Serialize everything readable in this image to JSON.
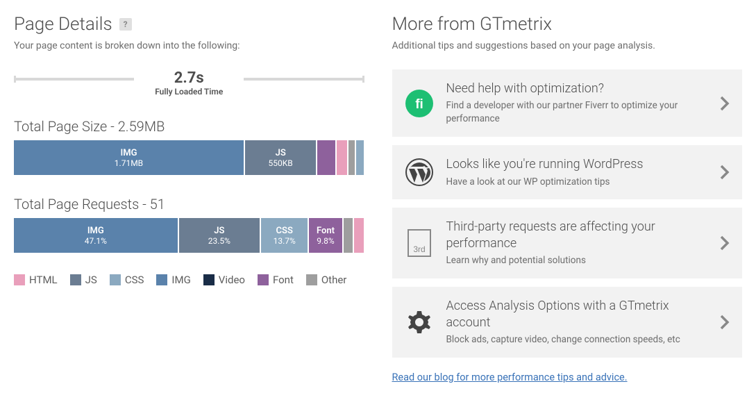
{
  "left": {
    "title": "Page Details",
    "subtitle": "Your page content is broken down into the following:",
    "load_time_value": "2.7s",
    "load_time_label": "Fully Loaded Time",
    "size_title": "Total Page Size - 2.59MB",
    "requests_title": "Total Page Requests - 51"
  },
  "right": {
    "title": "More from GTmetrix",
    "subtitle": "Additional tips and suggestions based on your page analysis.",
    "tips": [
      {
        "title": "Need help with optimization?",
        "desc": "Find a developer with our partner Fiverr to optimize your performance"
      },
      {
        "title": "Looks like you're running WordPress",
        "desc": "Have a look at our WP optimization tips"
      },
      {
        "title": "Third-party requests are affecting your performance",
        "desc": "Learn why and potential solutions"
      },
      {
        "title": "Access Analysis Options with a GTmetrix account",
        "desc": "Block ads, capture video, change connection speeds, etc"
      }
    ],
    "blog_link": "Read our blog for more performance tips and advice."
  },
  "legend": [
    "HTML",
    "JS",
    "CSS",
    "IMG",
    "Video",
    "Font",
    "Other"
  ],
  "colors": {
    "HTML": "#e99fbb",
    "JS": "#6b7d92",
    "CSS": "#8ba9c0",
    "IMG": "#5a82ab",
    "Video": "#1a2d47",
    "Font": "#8e619c",
    "Other": "#9e9e9e"
  },
  "chart_data": [
    {
      "type": "bar",
      "title": "Total Page Size - 2.59MB",
      "total": "2.59MB",
      "segments": [
        {
          "name": "IMG",
          "label": "IMG",
          "value": "1.71MB",
          "percent": 66.0
        },
        {
          "name": "JS",
          "label": "JS",
          "value": "550KB",
          "percent": 20.7
        },
        {
          "name": "Font",
          "label": "",
          "value": "",
          "percent": 5.5
        },
        {
          "name": "HTML",
          "label": "",
          "value": "",
          "percent": 3.4
        },
        {
          "name": "Other",
          "label": "",
          "value": "",
          "percent": 2.2
        },
        {
          "name": "CSS",
          "label": "",
          "value": "",
          "percent": 2.2
        }
      ]
    },
    {
      "type": "bar",
      "title": "Total Page Requests - 51",
      "total": 51,
      "segments": [
        {
          "name": "IMG",
          "label": "IMG",
          "value": "47.1%",
          "percent": 47.1
        },
        {
          "name": "JS",
          "label": "JS",
          "value": "23.5%",
          "percent": 23.5
        },
        {
          "name": "CSS",
          "label": "CSS",
          "value": "13.7%",
          "percent": 13.7
        },
        {
          "name": "Font",
          "label": "Font",
          "value": "9.8%",
          "percent": 9.8
        },
        {
          "name": "Other",
          "label": "",
          "value": "",
          "percent": 3.0
        },
        {
          "name": "HTML",
          "label": "",
          "value": "",
          "percent": 2.9
        }
      ]
    }
  ]
}
